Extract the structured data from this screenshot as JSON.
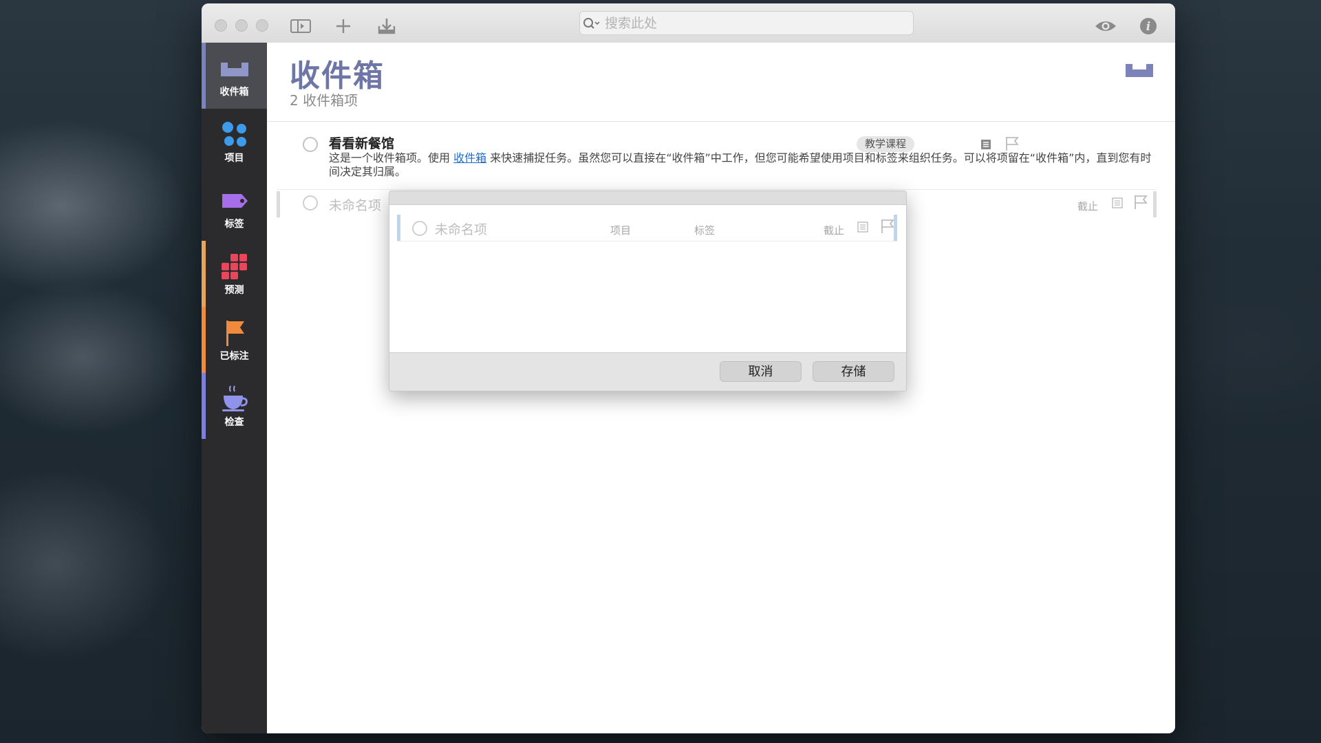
{
  "toolbar": {
    "search_placeholder": "搜索此处"
  },
  "sidebar": {
    "items": [
      {
        "label": "收件箱",
        "icon": "inbox-icon",
        "color": "#7c83b8"
      },
      {
        "label": "项目",
        "icon": "projects-icon",
        "color": "#3d9be9"
      },
      {
        "label": "标签",
        "icon": "tag-icon",
        "color": "#a66ee8"
      },
      {
        "label": "预测",
        "icon": "forecast-icon",
        "color": "#e8475b"
      },
      {
        "label": "已标注",
        "icon": "flag-icon",
        "color": "#f08a3c"
      },
      {
        "label": "检查",
        "icon": "review-icon",
        "color": "#7c7fe0"
      }
    ]
  },
  "header": {
    "title": "收件箱",
    "subtitle": "2 收件箱项"
  },
  "tasks": [
    {
      "title": "看看新餐馆",
      "tag": "教学课程",
      "note_before": "这是一个收件箱项。使用 ",
      "note_link": "收件箱",
      "note_after": " 来快速捕捉任务。虽然您可以直接在“收件箱”中工作，但您可能希望使用项目和标签来组织任务。可以将项留在“收件箱”内，直到您有时间决定其归属。"
    },
    {
      "title_placeholder": "未命名项",
      "due_label": "截止"
    }
  ],
  "dialog": {
    "title_placeholder": "未命名项",
    "project_label": "项目",
    "tags_label": "标签",
    "due_label": "截止",
    "cancel_label": "取消",
    "save_label": "存储"
  }
}
